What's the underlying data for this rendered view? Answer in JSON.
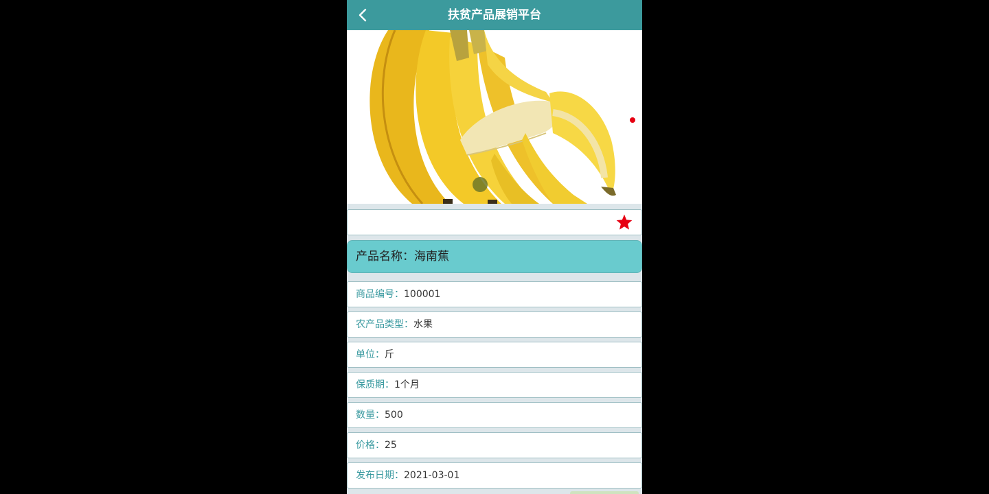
{
  "header": {
    "title": "扶贫产品展销平台",
    "back_icon": "chevron-left-icon"
  },
  "banner": {
    "image_alt": "banana",
    "indicator_count": 1
  },
  "favorite": {
    "icon": "star-icon",
    "color": "#e60012"
  },
  "product_name": {
    "label": "产品名称：",
    "value": "海南蕉"
  },
  "details": [
    {
      "label": "商品编号：",
      "value": "100001"
    },
    {
      "label": "农产品类型：",
      "value": "水果"
    },
    {
      "label": "单位：",
      "value": "斤"
    },
    {
      "label": "保质期：",
      "value": "1个月"
    },
    {
      "label": "数量：",
      "value": "500"
    },
    {
      "label": "价格：",
      "value": "25"
    },
    {
      "label": "发布日期：",
      "value": "2021-03-01"
    }
  ],
  "colors": {
    "header": "#3c9a9d",
    "name_row": "#69cbce",
    "label": "#3a9aa0"
  }
}
